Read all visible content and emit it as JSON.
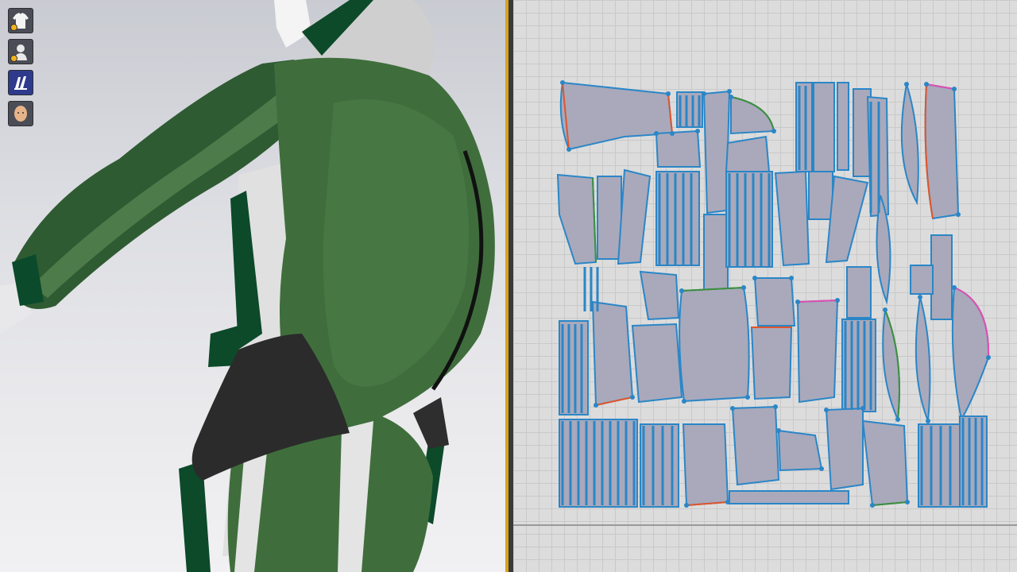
{
  "app": {
    "name": ""
  },
  "toolbar3d": {
    "buttons": [
      {
        "icon": "garment-shirt-icon"
      },
      {
        "icon": "avatar-body-icon"
      },
      {
        "icon": "render-mode-icon"
      },
      {
        "icon": "avatar-face-icon"
      }
    ]
  },
  "colors": {
    "garment_green": "#3f6e3c",
    "garment_dark_green": "#0c4a2a",
    "panel_fill": "#a9a9bb",
    "seam_blue": "#2a86c7",
    "accent_orange": "#d6a21f"
  }
}
